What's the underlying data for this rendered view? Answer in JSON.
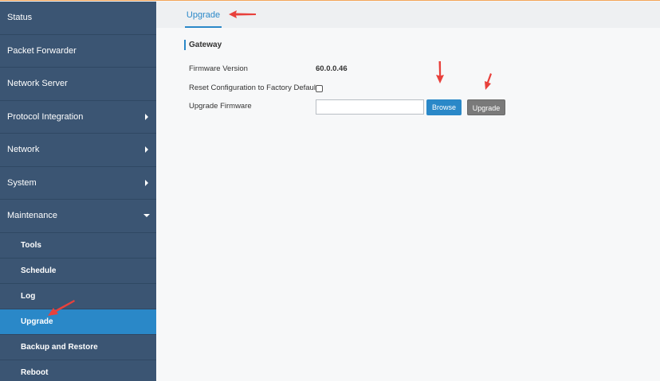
{
  "sidebar": {
    "items": [
      {
        "label": "Status"
      },
      {
        "label": "Packet Forwarder"
      },
      {
        "label": "Network Server"
      },
      {
        "label": "Protocol Integration"
      },
      {
        "label": "Network"
      },
      {
        "label": "System"
      },
      {
        "label": "Maintenance"
      }
    ],
    "sub_items": [
      {
        "label": "Tools"
      },
      {
        "label": "Schedule"
      },
      {
        "label": "Log"
      },
      {
        "label": "Upgrade"
      },
      {
        "label": "Backup and Restore"
      },
      {
        "label": "Reboot"
      }
    ]
  },
  "header": {
    "tab_label": "Upgrade"
  },
  "main": {
    "section_title": "Gateway",
    "firmware_version_label": "Firmware Version",
    "firmware_version_value": "60.0.0.46",
    "reset_label": "Reset Configuration to Factory Default",
    "upgrade_firmware_label": "Upgrade Firmware",
    "file_value": "",
    "browse_label": "Browse",
    "upgrade_button_label": "Upgrade"
  },
  "colors": {
    "sidebar_bg": "#3b5573",
    "active_item": "#2a88c8",
    "annotation_arrow": "#e8413c"
  }
}
